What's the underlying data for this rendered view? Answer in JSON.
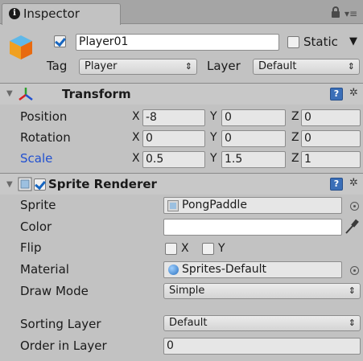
{
  "tab": {
    "label": "Inspector"
  },
  "header": {
    "name_value": "Player01",
    "static_label": "Static",
    "tag_label": "Tag",
    "tag_value": "Player",
    "layer_label": "Layer",
    "layer_value": "Default"
  },
  "transform": {
    "title": "Transform",
    "rows": [
      {
        "label": "Position",
        "x": "-8",
        "y": "0",
        "z": "0"
      },
      {
        "label": "Rotation",
        "x": "0",
        "y": "0",
        "z": "0"
      },
      {
        "label": "Scale",
        "x": "0.5",
        "y": "1.5",
        "z": "1"
      }
    ],
    "axis_x": "X",
    "axis_y": "Y",
    "axis_z": "Z"
  },
  "sprite_renderer": {
    "title": "Sprite Renderer",
    "sprite_label": "Sprite",
    "sprite_value": "PongPaddle",
    "color_label": "Color",
    "color_value": "#ffffff",
    "flip_label": "Flip",
    "flip_x": "X",
    "flip_y": "Y",
    "material_label": "Material",
    "material_value": "Sprites-Default",
    "draw_mode_label": "Draw Mode",
    "draw_mode_value": "Simple",
    "sorting_layer_label": "Sorting Layer",
    "sorting_layer_value": "Default",
    "order_label": "Order in Layer",
    "order_value": "0"
  },
  "icons": {
    "tab": "info-icon",
    "lock": "lock-icon",
    "menu": "menu-icon",
    "object": "cube-icon",
    "transform": "transform-axes-icon",
    "sprite_renderer": "sprite-renderer-icon",
    "help": "help-icon",
    "settings": "gear-icon",
    "picker": "object-picker-icon",
    "eyedropper": "eyedropper-icon"
  },
  "colors": {
    "panel_bg": "#c2c2c2",
    "accent_blue": "#2150d0",
    "checkbox_check": "#1565c0"
  }
}
